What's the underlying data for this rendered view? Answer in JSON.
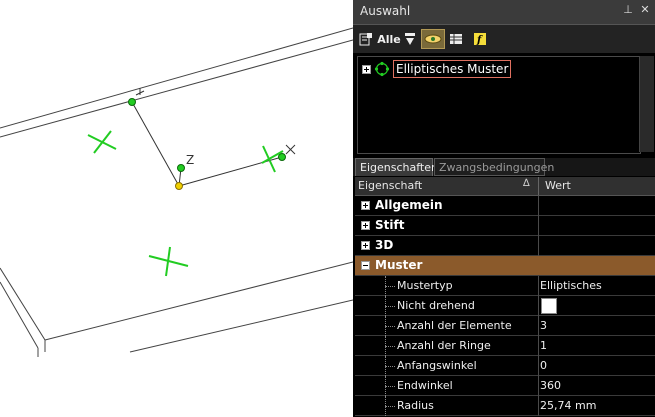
{
  "viewport": {
    "axis_labels": {
      "y": "Y",
      "z": "Z",
      "x": "X"
    }
  },
  "panel": {
    "title": "Auswahl",
    "title_buttons": [
      "pin-icon",
      "close-icon"
    ],
    "toolbar": {
      "select_label": "Alle",
      "items": [
        "properties-icon",
        "select-all-icon",
        "filter-icon",
        "visibility-icon",
        "table-icon",
        "function-icon"
      ]
    },
    "tree": {
      "node_label": "Elliptisches Muster",
      "node_icon": "pattern-icon"
    },
    "tabs": {
      "properties": "Eigenschaften",
      "constraints": "Zwangsbedingungen"
    },
    "grid": {
      "col_property": "Eigenschaft",
      "sort_glyph": "∆",
      "col_value": "Wert",
      "groups": {
        "general": "Allgemein",
        "pen": "Stift",
        "three_d": "3D",
        "pattern": "Muster"
      },
      "properties": {
        "pattern_type": {
          "label": "Mustertyp",
          "value": "Elliptisches"
        },
        "non_rotating": {
          "label": "Nicht drehend",
          "value": ""
        },
        "element_count": {
          "label": "Anzahl der Elemente",
          "value": "3"
        },
        "ring_count": {
          "label": "Anzahl der Ringe",
          "value": "1"
        },
        "start_angle": {
          "label": "Anfangswinkel",
          "value": "0"
        },
        "end_angle": {
          "label": "Endwinkel",
          "value": "360"
        },
        "radius": {
          "label": "Radius",
          "value": "25,74 mm"
        }
      }
    }
  },
  "colors": {
    "panel_bg": "#000000",
    "group_highlight": "#8b5a2b",
    "marker_green": "#22cc22",
    "origin_yellow": "#f0d000"
  }
}
